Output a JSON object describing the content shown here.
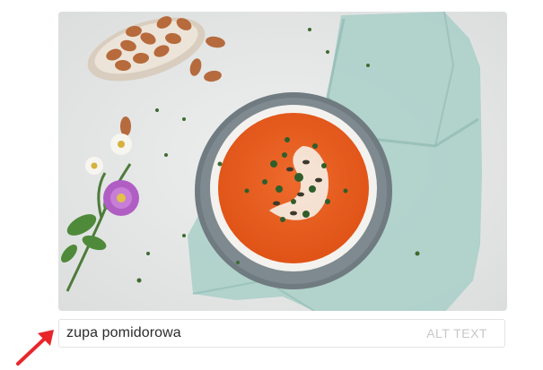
{
  "image": {
    "description_icon": "soup-photo",
    "alt_text_value": "zupa pomidorowa",
    "alt_text_label": "ALT TEXT"
  },
  "colors": {
    "arrow": "#e8262a",
    "field_border": "#e3e3e3",
    "label_gray": "#c7c7c7"
  }
}
